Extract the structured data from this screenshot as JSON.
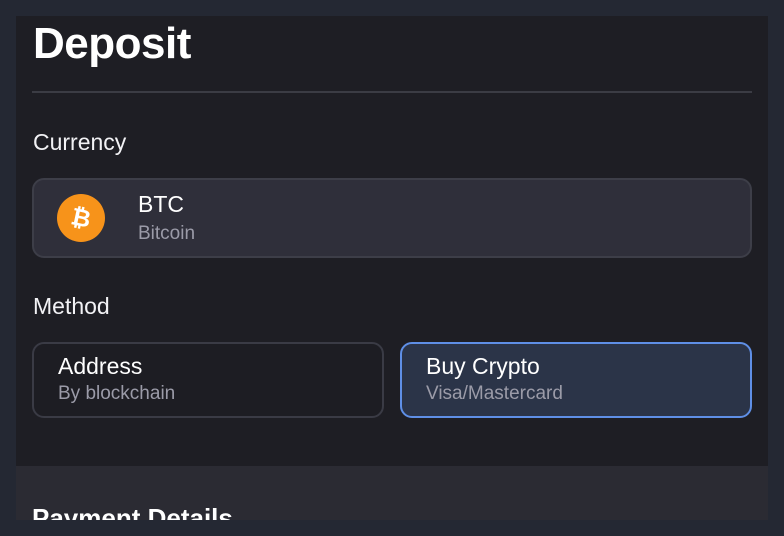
{
  "header": {
    "title": "Deposit"
  },
  "currency": {
    "label": "Currency",
    "selected": {
      "code": "BTC",
      "name": "Bitcoin",
      "icon": "bitcoin-icon",
      "icon_color": "#f7931a"
    }
  },
  "method": {
    "label": "Method",
    "options": [
      {
        "title": "Address",
        "subtitle": "By blockchain",
        "selected": false
      },
      {
        "title": "Buy Crypto",
        "subtitle": "Visa/Mastercard",
        "selected": true
      }
    ],
    "selected_border_color": "#5f8fe6"
  },
  "payment": {
    "title": "Payment Details"
  }
}
